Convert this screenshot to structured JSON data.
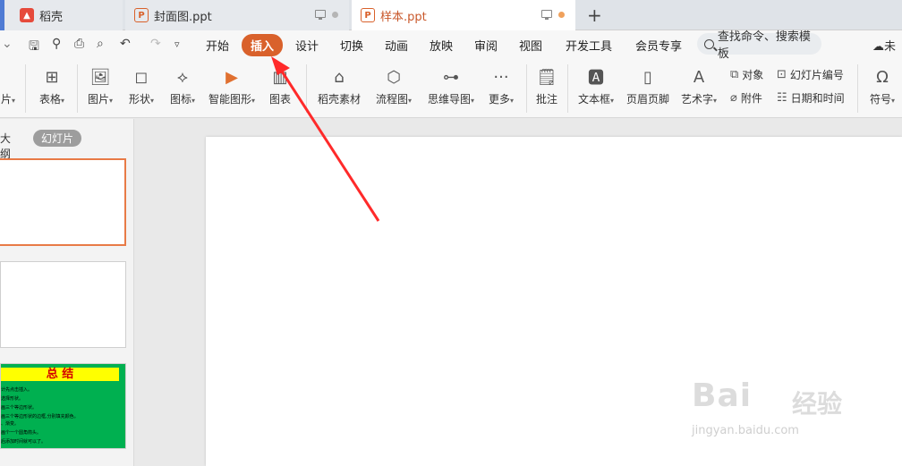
{
  "tabs": [
    {
      "label": "稻壳"
    },
    {
      "label": "封面图.ppt"
    },
    {
      "label": "样本.ppt"
    }
  ],
  "menu": {
    "items": [
      "开始",
      "插入",
      "设计",
      "切换",
      "动画",
      "放映",
      "审阅",
      "视图",
      "开发工具",
      "会员专享"
    ],
    "search_placeholder": "查找命令、搜索模板",
    "cloud_label": "未"
  },
  "ribbon": {
    "items": [
      "片",
      "表格",
      "图片",
      "形状",
      "图标",
      "智能图形",
      "图表",
      "稻壳素材",
      "流程图",
      "思维导图",
      "更多",
      "批注",
      "文本框",
      "页眉页脚",
      "艺术字",
      "符号"
    ],
    "small": [
      "对象",
      "幻灯片编号",
      "附件",
      "日期和时间"
    ]
  },
  "panel": {
    "tab_outline": "大纲",
    "tab_slides": "幻灯片",
    "thumb3_title": "总 结",
    "thumb3_lines": [
      "计先点击插入。",
      "选择形状。",
      "画三个等边形状。",
      "画三个等边形状的边框,分别填充颜色。",
      "、渐变。",
      "画个一个圆角箭头。",
      "后添加时间就可以了。"
    ]
  },
  "watermark": {
    "text": "Bai",
    "zh": "经验",
    "url": "jingyan.baidu.com"
  },
  "colors": {
    "accent": "#d9612b",
    "arrow": "#ff2a2a",
    "thumb_green": "#00b050",
    "thumb_yellow": "#ffff00"
  }
}
